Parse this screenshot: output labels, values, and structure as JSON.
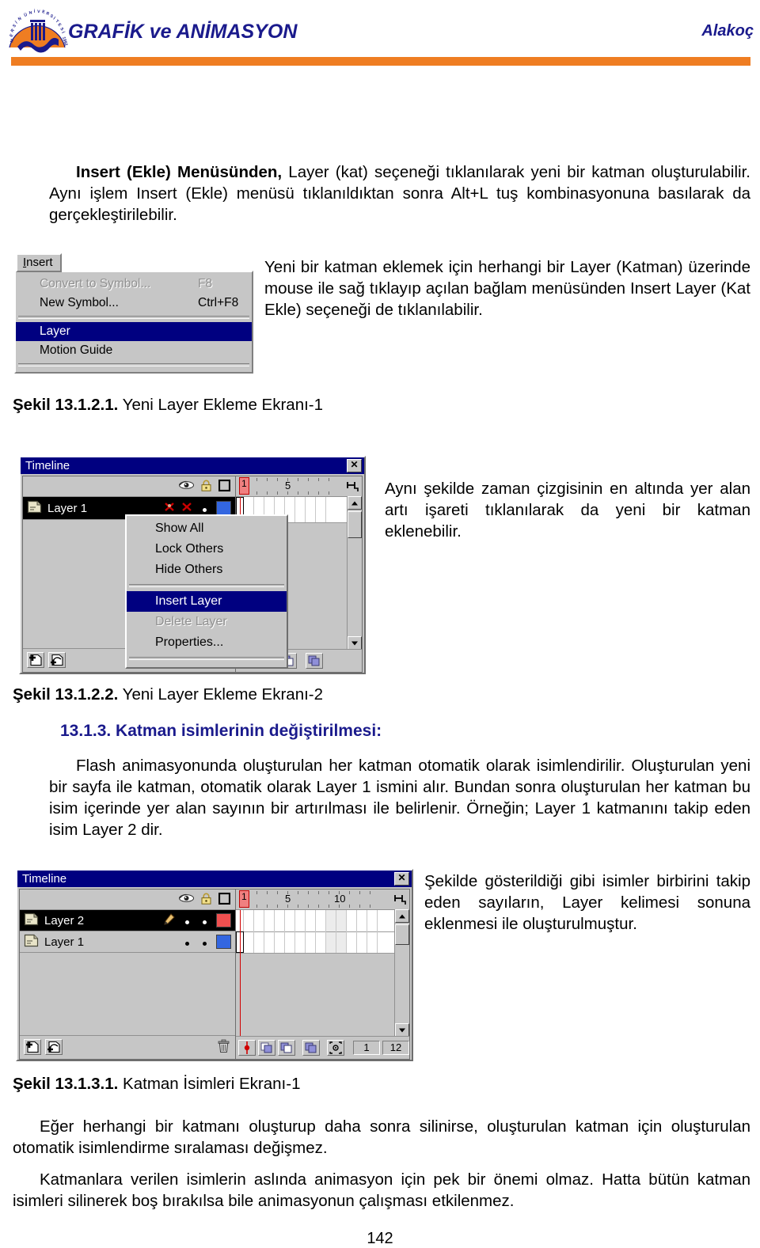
{
  "header": {
    "title": "GRAFİK ve ANİMASYON",
    "author": "Alakoç",
    "logo_name": "mersin-universitesi-logo",
    "title_color": "#1a1a8c",
    "rule_color": "#ef7d22"
  },
  "intro": {
    "bold_lead": "Insert (Ekle) Menüsünden,",
    "rest": " Layer (kat) seçeneği tıklanılarak yeni bir katman oluşturulabilir. Aynı işlem Insert (Ekle) menüsü tıklanıldıktan sonra Alt+L tuş kombinasyonuna basılarak da gerçekleştirilebilir."
  },
  "insert_menu": {
    "menubar_label": "Insert",
    "menubar_accel_letter": "I",
    "items": [
      {
        "label": "Convert to Symbol...",
        "accel": "F8",
        "state": "disabled"
      },
      {
        "label": "New Symbol...",
        "accel": "Ctrl+F8",
        "state": "normal"
      },
      {
        "label": "SEPARATOR",
        "accel": "",
        "state": "separator"
      },
      {
        "label": "Layer",
        "accel": "",
        "state": "selected"
      },
      {
        "label": "Motion Guide",
        "accel": "",
        "state": "normal"
      }
    ]
  },
  "fig1_text": "Yeni bir katman eklemek için herhangi bir Layer (Katman) üzerinde mouse ile sağ tıklayıp açılan bağlam menüsünden Insert Layer (Kat Ekle) seçeneği de tıklanılabilir.",
  "caption1": {
    "bold": "Şekil 13.1.2.1.",
    "rest": " Yeni Layer Ekleme Ekranı-1"
  },
  "timeline1": {
    "window_title": "Timeline",
    "close_label": "✕",
    "ruler_numbers": [
      "1",
      "5"
    ],
    "playhead_frame": "1",
    "layers": [
      {
        "name": "Layer 1",
        "active": true,
        "swatch_color": "#3366e0"
      }
    ],
    "context_menu": [
      {
        "label": "Show All",
        "state": "normal"
      },
      {
        "label": "Lock Others",
        "state": "normal"
      },
      {
        "label": "Hide Others",
        "state": "normal"
      },
      {
        "label": "SEPARATOR",
        "state": "separator"
      },
      {
        "label": "Insert Layer",
        "state": "selected"
      },
      {
        "label": "Delete Layer",
        "state": "disabled"
      },
      {
        "label": "Properties...",
        "state": "normal"
      }
    ],
    "icons": {
      "eye": "eye-icon",
      "lock": "lock-icon",
      "outline": "outline-square-icon",
      "insert_layer": "insert-layer-icon",
      "add_guide": "add-motion-guide-icon",
      "onion_skin": "onion-skin-icon",
      "onion_outline": "onion-skin-outline-icon",
      "edit_multiple": "edit-multiple-frames-icon"
    }
  },
  "fig2_text": "Aynı şekilde zaman çizgisinin en altında yer alan artı işareti tıklanılarak da yeni bir katman eklenebilir.",
  "caption2": {
    "bold": "Şekil 13.1.2.2.",
    "rest": " Yeni Layer Ekleme Ekranı-2"
  },
  "section": {
    "heading": "13.1.3. Katman isimlerinin değiştirilmesi:",
    "heading_color": "#1a1a8c",
    "paragraph": "Flash animasyonunda oluşturulan her katman otomatik olarak isimlendirilir. Oluşturulan yeni bir sayfa ile katman, otomatik olarak Layer 1 ismini alır. Bundan sonra oluşturulan her katman bu isim içerinde yer alan sayının bir artırılması ile belirlenir. Örneğin; Layer 1 katmanını takip eden isim Layer 2 dir."
  },
  "timeline2": {
    "window_title": "Timeline",
    "close_label": "✕",
    "ruler_numbers": [
      "1",
      "5",
      "10"
    ],
    "playhead_frame": "1",
    "layers": [
      {
        "name": "Layer 2",
        "active": true,
        "swatch_color": "#f05050"
      },
      {
        "name": "Layer 1",
        "active": false,
        "swatch_color": "#3366e0"
      }
    ],
    "status_current_frame": "1",
    "status_fps": "12",
    "icons": {
      "eye": "eye-icon",
      "lock": "lock-icon",
      "outline": "outline-square-icon",
      "pencil": "pencil-icon",
      "trash": "trash-icon",
      "insert_layer": "insert-layer-icon",
      "add_guide": "add-motion-guide-icon",
      "center_frame": "center-frame-icon",
      "onion_skin": "onion-skin-icon",
      "onion_outline": "onion-skin-outline-icon",
      "edit_multiple": "edit-multiple-frames-icon",
      "modify_markers": "modify-onion-markers-icon"
    }
  },
  "fig3_text": "Şekilde gösterildiği gibi isimler birbirini takip eden sayıların, Layer kelimesi sonuna eklenmesi ile oluşturulmuştur.",
  "caption3": {
    "bold": "Şekil 13.1.3.1.",
    "rest": " Katman İsimleri Ekranı-1"
  },
  "end_paragraph_1": "Eğer herhangi bir katmanı oluşturup daha sonra silinirse, oluşturulan katman için oluşturulan otomatik isimlendirme sıralaması değişmez.",
  "end_paragraph_2": "Katmanlara verilen isimlerin aslında animasyon için pek bir önemi olmaz. Hatta bütün katman isimleri silinerek boş bırakılsa bile animasyonun çalışması etkilenmez.",
  "page_number": "142"
}
